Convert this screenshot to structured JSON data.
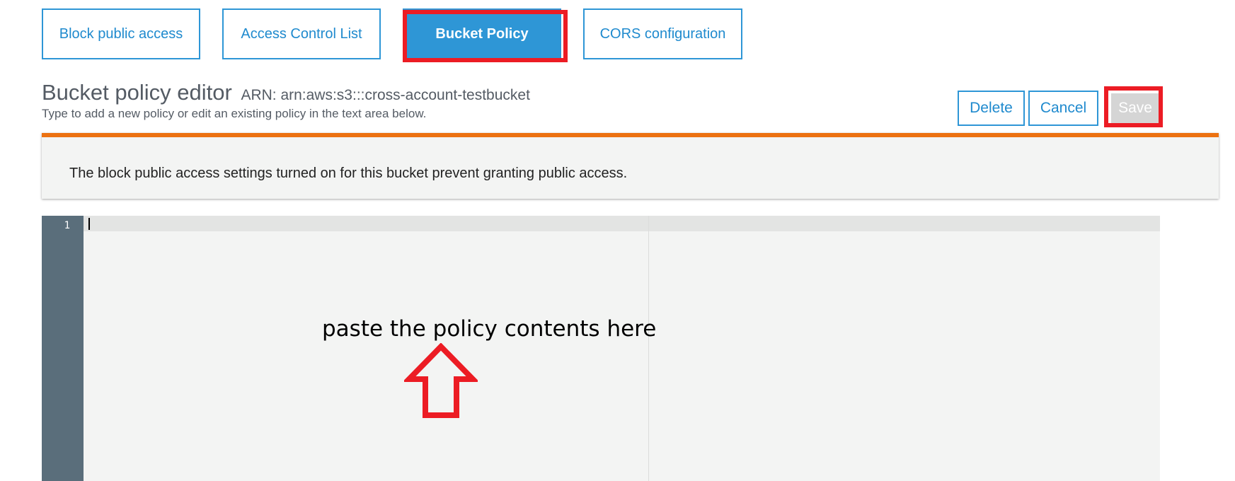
{
  "tabs": [
    {
      "label": "Block public access",
      "active": false
    },
    {
      "label": "Access Control List",
      "active": false
    },
    {
      "label": "Bucket Policy",
      "active": true
    },
    {
      "label": "CORS configuration",
      "active": false
    }
  ],
  "editor": {
    "title": "Bucket policy editor",
    "arn": "ARN: arn:aws:s3:::cross-account-testbucket",
    "subtitle": "Type to add a new policy or edit an existing policy in the text area below."
  },
  "actions": {
    "delete_label": "Delete",
    "cancel_label": "Cancel",
    "save_label": "Save"
  },
  "alert": {
    "message": "The block public access settings turned on for this bucket prevent granting public access."
  },
  "code": {
    "line_numbers": [
      "1"
    ],
    "content": ""
  },
  "annotation": {
    "hint": "paste the policy contents here"
  },
  "colors": {
    "accent": "#2e96d6",
    "alert_border": "#ec7211",
    "annotation_red": "#ec1c24",
    "gutter": "#5a6e7b"
  }
}
